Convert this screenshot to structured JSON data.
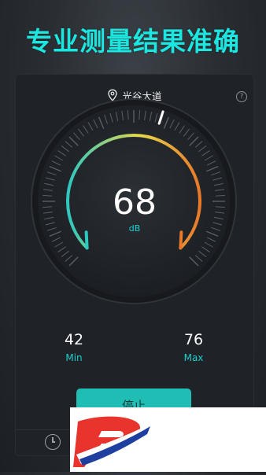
{
  "headline": "专业测量结果准确",
  "location": {
    "name": "光谷大道"
  },
  "help": {
    "label": "?"
  },
  "meter": {
    "value": "68",
    "unit": "dB",
    "level": 68
  },
  "min": {
    "value": "42",
    "label": "Min"
  },
  "max": {
    "value": "76",
    "label": "Max"
  },
  "stop_button": {
    "label": "停止"
  },
  "colors": {
    "accent": "#1ecfd0",
    "gauge_start": "#2ec8c0",
    "gauge_mid": "#e8d84a",
    "gauge_end": "#e8782a",
    "button": "#1fbdb3"
  },
  "icons": {
    "location": "location-pin-icon",
    "help": "help-icon",
    "history": "clock-icon",
    "logo": "brand-logo"
  }
}
